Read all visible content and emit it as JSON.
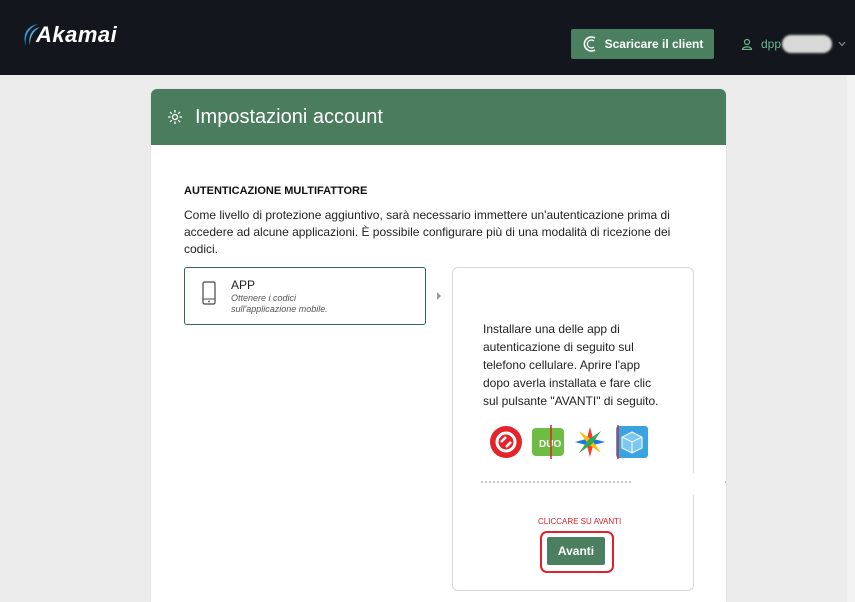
{
  "header": {
    "logo_text": "Akamai",
    "download_label": "Scaricare il client",
    "user_prefix": "dpp"
  },
  "panel": {
    "title": "Impostazioni account",
    "section_title": "AUTENTICAZIONE MULTIFATTORE",
    "description": "Come livello di protezione aggiuntivo, sarà necessario immettere un'autenticazione prima di accedere ad alcune applicazioni. È possibile configurare più di una modalità di ricezione dei codici."
  },
  "option": {
    "title": "APP",
    "subtitle": "Ottenere i codici sull'applicazione mobile."
  },
  "info": {
    "text": "Installare una delle app di autenticazione di seguito sul telefono cellulare. Aprire l'app dopo averla installata e fare clic sul pulsante \"AVANTI\" di seguito.",
    "app_icons": [
      "authy-icon",
      "duo-icon",
      "google-authenticator-icon",
      "cube-app-icon"
    ],
    "note": "CLICCARE SU AVANTI",
    "next_label": "Avanti"
  },
  "colors": {
    "topbar": "#13171d",
    "accent": "#4a7c5d",
    "button": "#4a8060",
    "highlight": "#e0202a"
  }
}
